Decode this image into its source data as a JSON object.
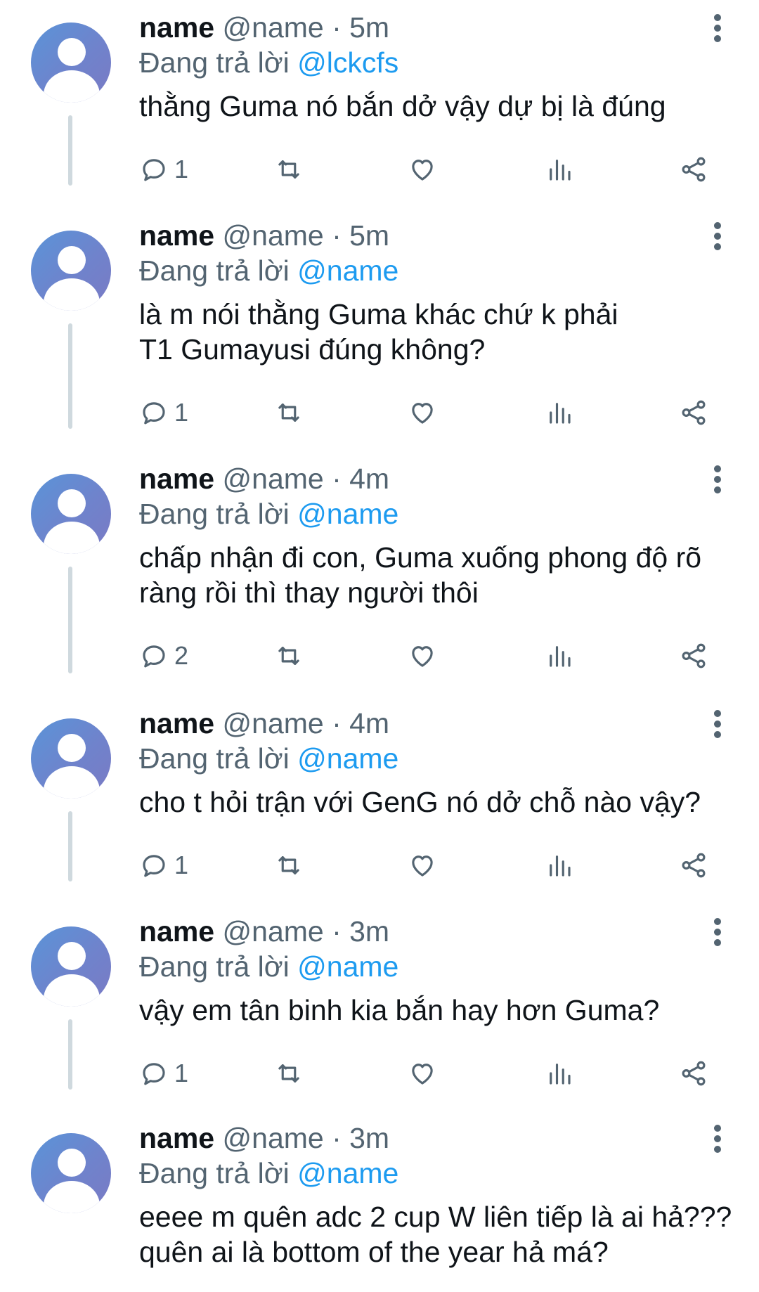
{
  "thread": {
    "reply_prefix": "Đang trả lời",
    "tweets": [
      {
        "name": "name",
        "handle_time": "@name · 5m",
        "reply_to": "@lckcfs",
        "text": "thằng Guma nó bắn dở vậy dự bị là đúng",
        "reply_count": "1"
      },
      {
        "name": "name",
        "handle_time": "@name · 5m",
        "reply_to": "@name",
        "text": "là m nói thằng Guma khác chứ k phải T1 Gumayusi đúng không?",
        "reply_count": "1"
      },
      {
        "name": "name",
        "handle_time": "@name · 4m",
        "reply_to": "@name",
        "text": "chấp nhận đi con, Guma xuống phong độ rõ ràng rồi thì thay người thôi",
        "reply_count": "2"
      },
      {
        "name": "name",
        "handle_time": "@name · 4m",
        "reply_to": "@name",
        "text": "cho t hỏi trận với GenG nó dở chỗ nào vậy?",
        "reply_count": "1"
      },
      {
        "name": "name",
        "handle_time": "@name · 3m",
        "reply_to": "@name",
        "text": "vậy em tân binh kia bắn hay hơn Guma?",
        "reply_count": "1"
      },
      {
        "name": "name",
        "handle_time": "@name · 3m",
        "reply_to": "@name",
        "text": "eeee m quên adc 2 cup W liên tiếp là ai hả??? quên ai là bottom of the year hả má?",
        "reply_count": ""
      }
    ]
  },
  "icons": {
    "reply": "reply-icon",
    "retweet": "retweet-icon",
    "like": "heart-icon",
    "views": "views-icon",
    "share": "share-icon",
    "more": "more-vertical-icon"
  },
  "colors": {
    "text": "#0f1419",
    "muted": "#536471",
    "link": "#1d9bf0",
    "thread_line": "#cfd9de"
  }
}
